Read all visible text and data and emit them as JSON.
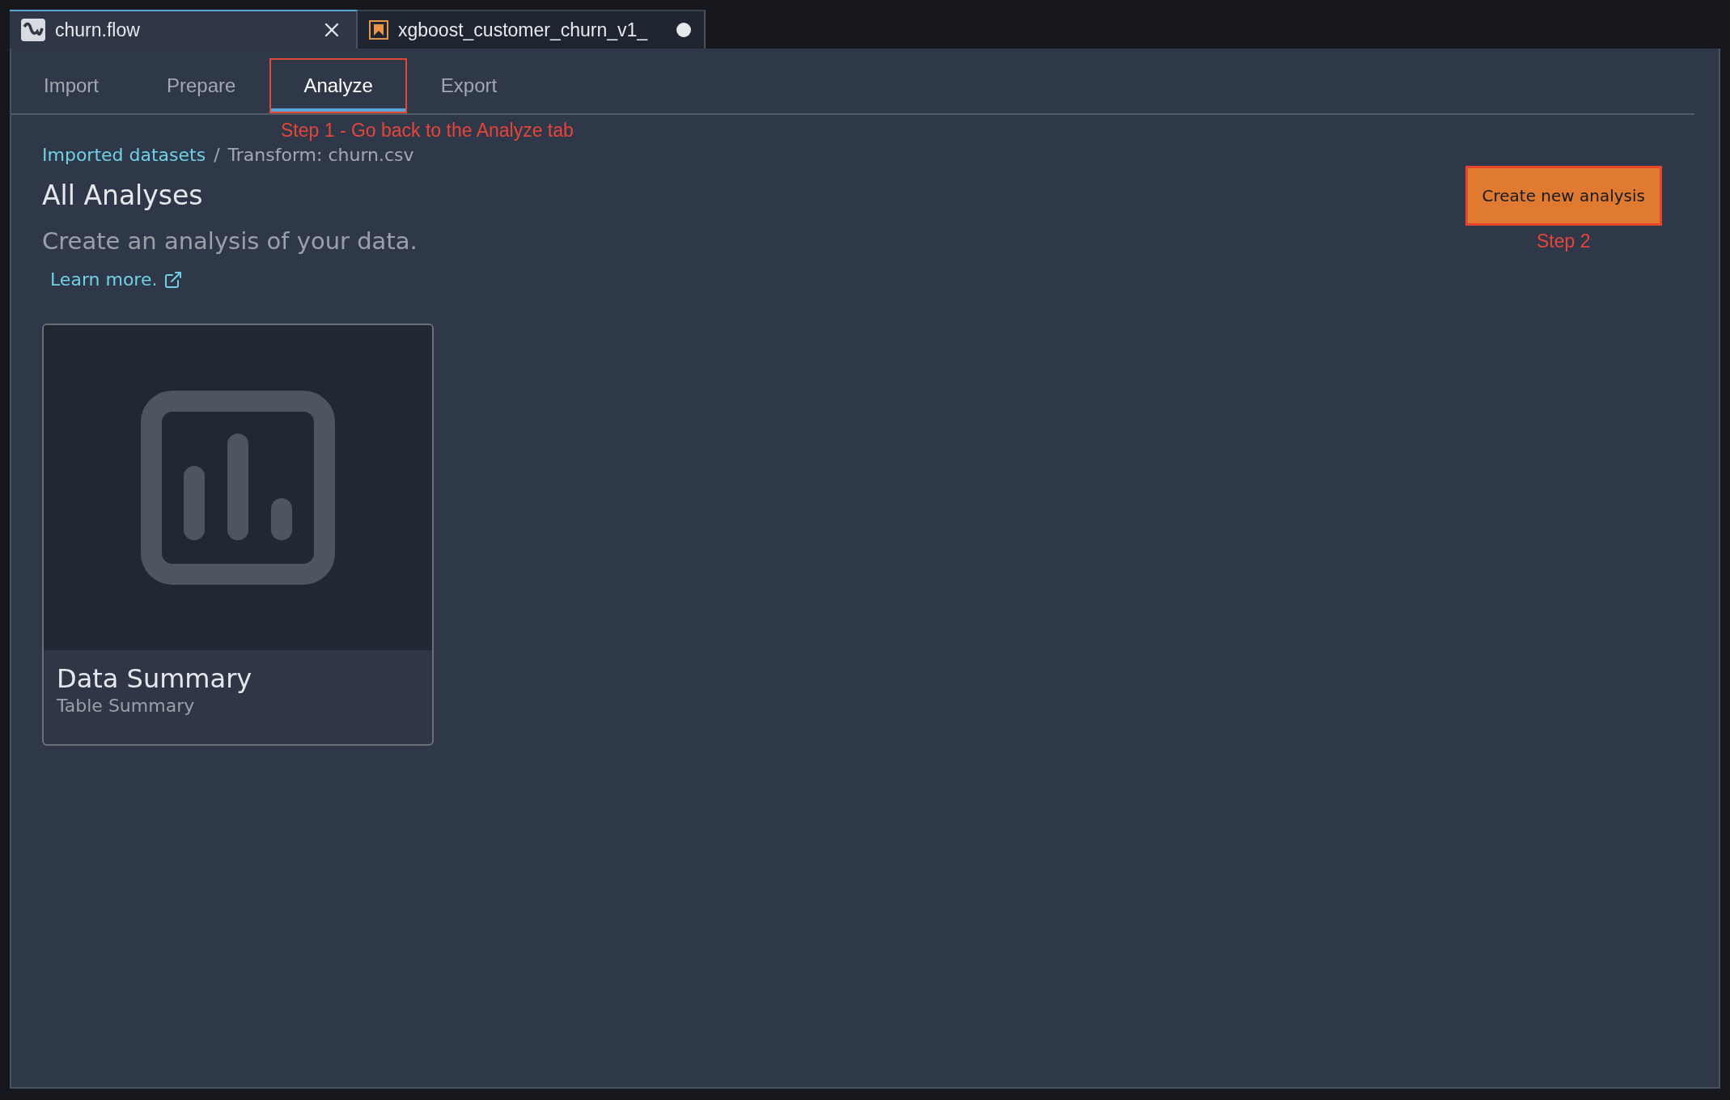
{
  "editor_tabs": [
    {
      "title": "churn.flow",
      "kind": "flow",
      "selected": true,
      "unsaved": false
    },
    {
      "title": "xgboost_customer_churn_v1_",
      "kind": "notebook",
      "selected": false,
      "unsaved": true
    }
  ],
  "tabs": [
    {
      "label": "Import",
      "selected": false,
      "highlighted": false
    },
    {
      "label": "Prepare",
      "selected": false,
      "highlighted": false
    },
    {
      "label": "Analyze",
      "selected": true,
      "highlighted": true
    },
    {
      "label": "Export",
      "selected": false,
      "highlighted": false
    }
  ],
  "tabs_annotation": "Step 1 - Go back to the Analyze tab",
  "breadcrumb": [
    {
      "label": "Imported datasets",
      "link": true
    },
    {
      "label": "Transform: churn.csv",
      "link": false
    }
  ],
  "breadcrumb_separator": "/",
  "title": "All Analyses",
  "subtitle": "Create an analysis of your data.",
  "learn_more": "Learn more.",
  "create_button": {
    "label": "Create new analysis",
    "highlighted": true
  },
  "create_button_annotation": "Step 2",
  "cards": [
    {
      "title": "Data Summary",
      "subtitle": "Table Summary"
    }
  ]
}
